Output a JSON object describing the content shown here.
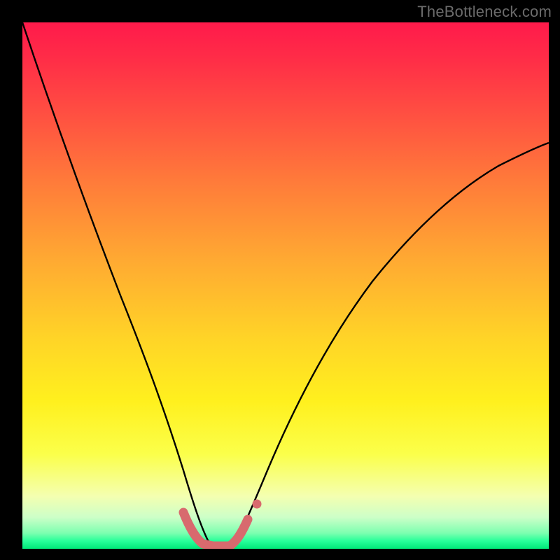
{
  "watermark": "TheBottleneck.com",
  "chart_data": {
    "type": "line",
    "title": "",
    "xlabel": "",
    "ylabel": "",
    "xlim": [
      0,
      100
    ],
    "ylim": [
      0,
      100
    ],
    "series": [
      {
        "name": "bottleneck-curve",
        "x": [
          0,
          5,
          10,
          15,
          18,
          21,
          24,
          27,
          29,
          31,
          33,
          35,
          37,
          39,
          42,
          45,
          50,
          55,
          60,
          65,
          70,
          75,
          80,
          85,
          90,
          95,
          100
        ],
        "values": [
          100,
          88,
          76,
          63,
          55,
          47,
          38,
          28,
          20,
          12,
          5,
          1,
          0,
          1,
          4,
          10,
          20,
          30,
          38,
          46,
          53,
          58,
          63,
          67,
          70,
          72,
          74
        ]
      },
      {
        "name": "highlight-band",
        "x": [
          29,
          31,
          33,
          35,
          37,
          39,
          41
        ],
        "values": [
          6,
          2,
          0.5,
          0.3,
          0.5,
          2,
          5
        ]
      }
    ],
    "background_gradient": {
      "top": "#ff1a4b",
      "mid": "#ffe61e",
      "bottom": "#00e878"
    }
  }
}
